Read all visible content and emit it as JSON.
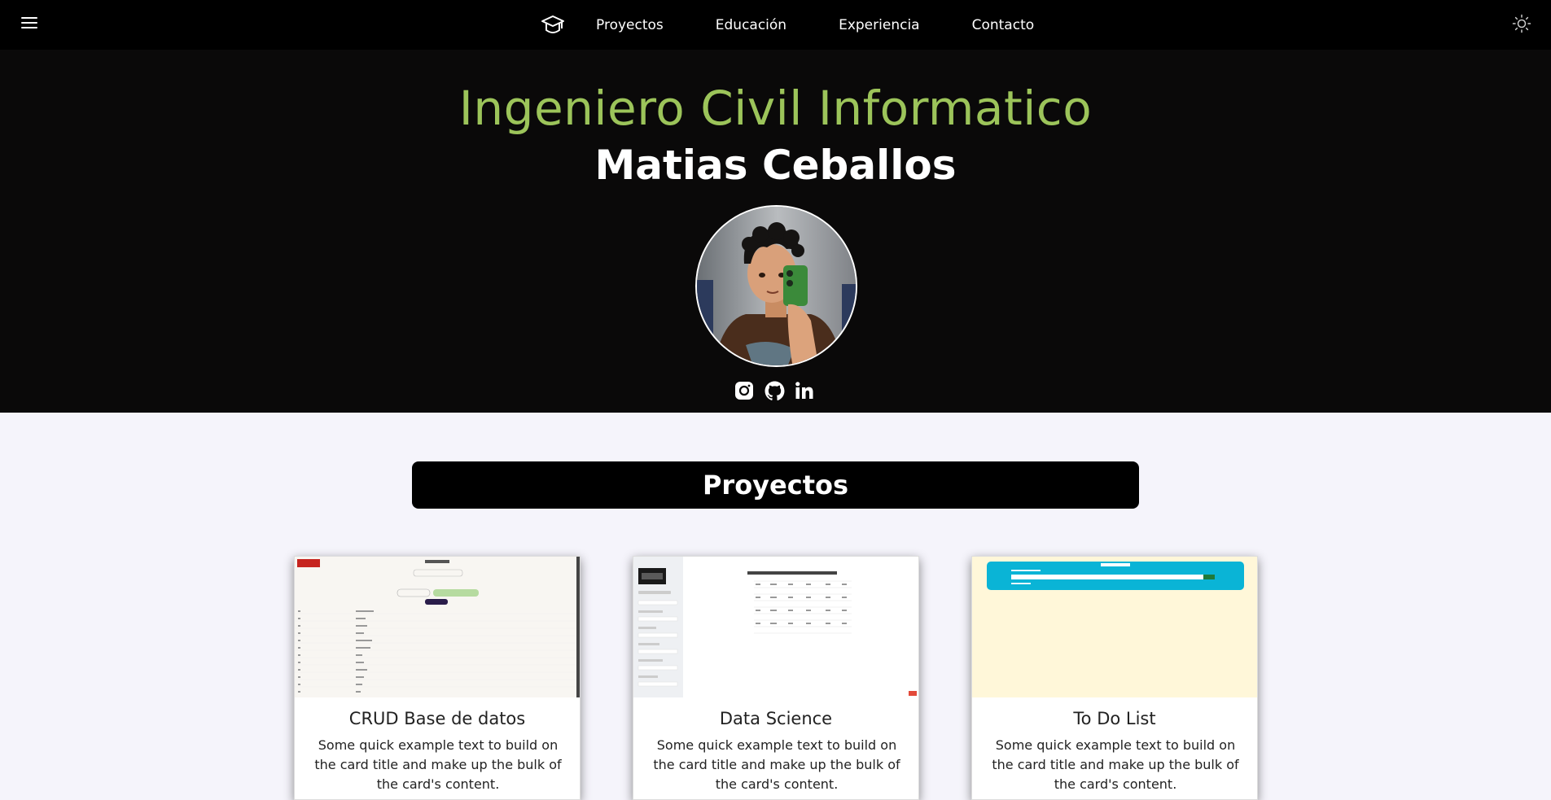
{
  "nav": {
    "links": [
      "Proyectos",
      "Educación",
      "Experiencia",
      "Contacto"
    ]
  },
  "icons": {
    "menu": "hamburger-icon",
    "brand": "graduation-cap-icon",
    "theme": "sun-icon",
    "socials": [
      "instagram-icon",
      "github-icon",
      "linkedin-icon"
    ]
  },
  "hero": {
    "role": "Ingeniero Civil Informatico",
    "name": "Matias Ceballos"
  },
  "projects": {
    "heading": "Proyectos",
    "cards": [
      {
        "title": "CRUD Base de datos",
        "text": "Some quick example text to build on the card title and make up the bulk of the card's content."
      },
      {
        "title": "Data Science",
        "text": "Some quick example text to build on the card title and make up the bulk of the card's content."
      },
      {
        "title": "To Do List",
        "text": "Some quick example text to build on the card title and make up the bulk of the card's content."
      }
    ]
  },
  "colors": {
    "accent": "#9cc45a",
    "hero_bg": "#0a0909",
    "nav_bg": "#000000",
    "page_bg": "#f5f4fb"
  }
}
